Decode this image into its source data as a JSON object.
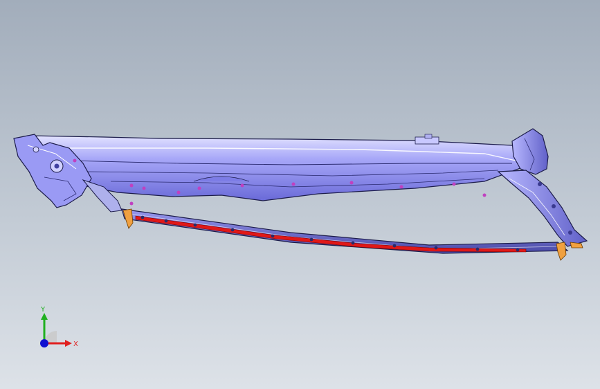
{
  "viewport": {
    "background_top": "#a2adbb",
    "background_bottom": "#dde2e8"
  },
  "model": {
    "body_color": "#8e8ef0",
    "highlight_color": "#c8c8ff",
    "outline_color": "#1c1c4a",
    "seal_strip_color": "#e01818",
    "clip_color": "#f0a040",
    "fastener_color": "#c040c0"
  },
  "triad": {
    "x_label": "X",
    "y_label": "Y",
    "x_color": "#e02020",
    "y_color": "#20b020",
    "z_color": "#1010d0",
    "icon": "coordinate-triad-icon"
  }
}
